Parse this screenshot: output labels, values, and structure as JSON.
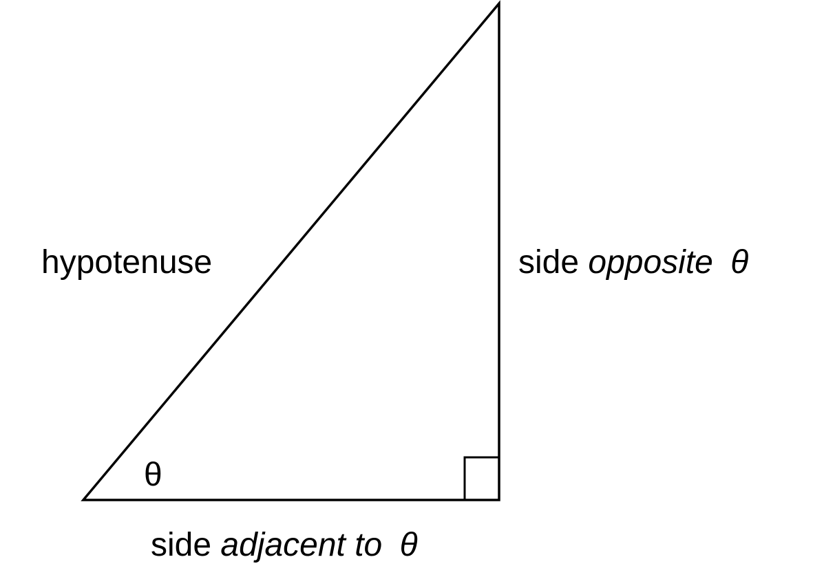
{
  "diagram": {
    "labels": {
      "hypotenuse": "hypotenuse",
      "opposite_prefix": "side ",
      "opposite_word": "opposite",
      "opposite_symbol": "θ",
      "adjacent_prefix": "side ",
      "adjacent_word": "adjacent to",
      "adjacent_symbol": "θ",
      "angle": "θ"
    },
    "colors": {
      "stroke": "#000000",
      "background": "#ffffff"
    }
  }
}
